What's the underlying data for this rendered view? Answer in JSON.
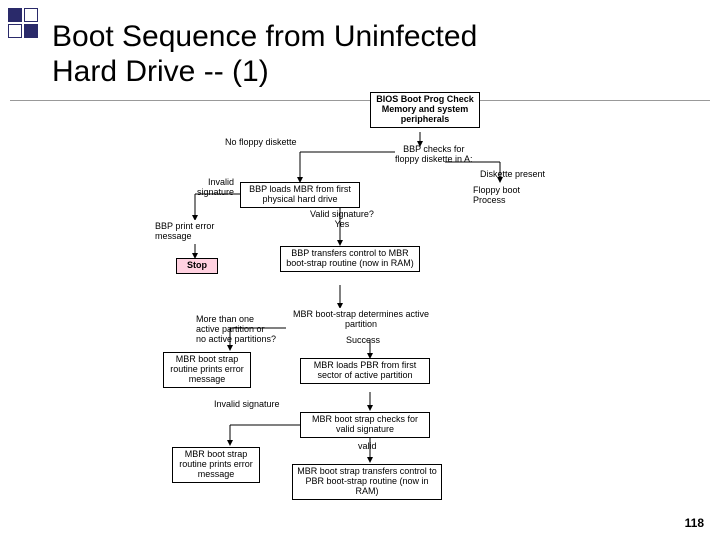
{
  "title": "Boot Sequence from Uninfected\nHard Drive  -- (1)",
  "page_number": "118",
  "boxes": {
    "bios": "BIOS Boot Prog\nCheck Memory and\nsystem peripherals",
    "bbp_load_mbr": "BBP loads MBR from\nfirst physical hard drive",
    "floppy_boot": "Floppy boot\nProcess",
    "bbp_error": "BBP print error\nmessage",
    "stop": "Stop",
    "bbp_transfer": "BBP transfers control\nto MBR boot-strap routine\n(now in RAM)",
    "mbr_determines": "MBR boot-strap determines\nactive partition",
    "mbr_routine_error1": "MBR boot strap\nroutine prints\nerror message",
    "mbr_loads_pbr": "MBR loads PBR from\nfirst sector of active\npartition",
    "mbr_checks_sig": "MBR boot strap checks\nfor valid signature",
    "mbr_routine_error2": "MBR boot strap\nroutine prints\nerror message",
    "mbr_transfers_pbr": "MBR boot strap transfers\ncontrol to PBR boot-strap\nroutine (now in RAM)"
  },
  "labels": {
    "no_floppy": "No floppy diskette",
    "bbp_checks": "BBP checks for\nfloppy diskette in A:",
    "diskette_present": "Diskette present",
    "invalid_sig": "Invalid\nsignature",
    "valid_sig": "Valid signature?\nYes",
    "more_than_one": "More than one\nactive partition or\nno active partitions?",
    "success": "Success",
    "invalid_sig2": "Invalid signature",
    "valid": "valid"
  }
}
